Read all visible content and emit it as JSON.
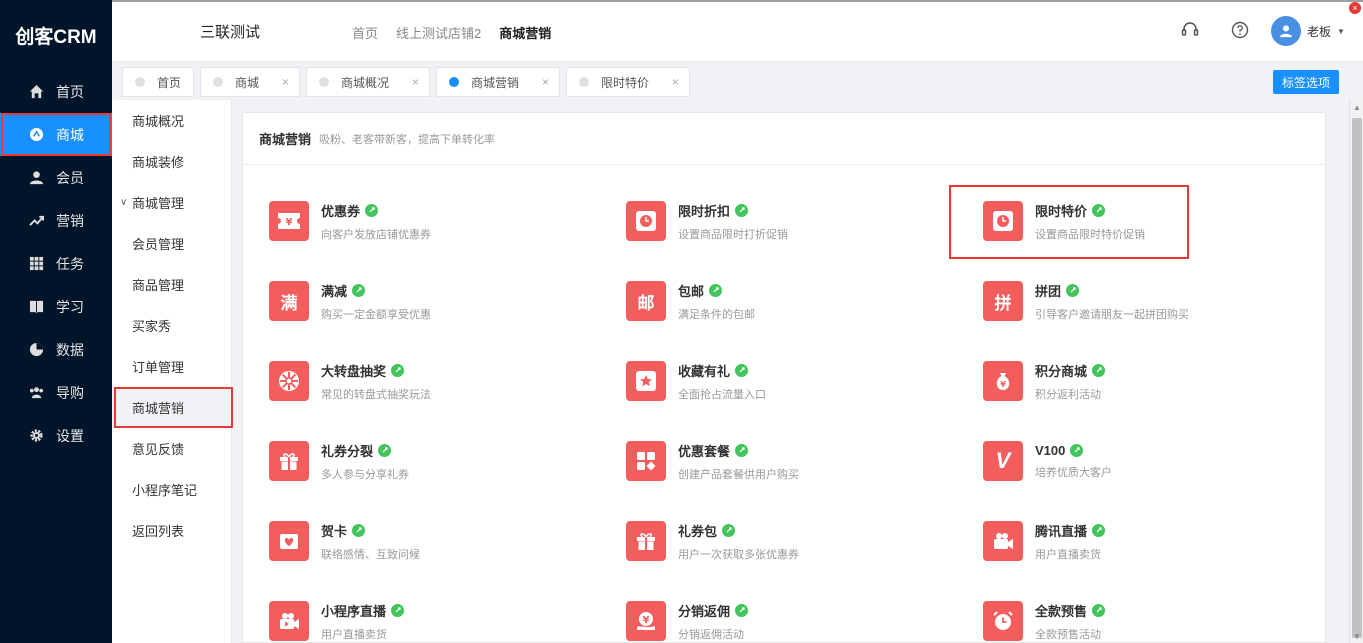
{
  "brand": "创客CRM",
  "nav": [
    {
      "label": "首页",
      "icon": "home-icon"
    },
    {
      "label": "商城",
      "icon": "shop-icon"
    },
    {
      "label": "会员",
      "icon": "member-icon"
    },
    {
      "label": "营销",
      "icon": "trend-icon"
    },
    {
      "label": "任务",
      "icon": "grid-icon"
    },
    {
      "label": "学习",
      "icon": "book-icon"
    },
    {
      "label": "数据",
      "icon": "pie-icon"
    },
    {
      "label": "导购",
      "icon": "group-icon"
    },
    {
      "label": "设置",
      "icon": "gear-icon"
    }
  ],
  "header": {
    "store": "三联测试",
    "crumbs": [
      "首页",
      "线上测试店铺2",
      "商城营销"
    ],
    "user": "老板"
  },
  "tabs": [
    {
      "label": "首页"
    },
    {
      "label": "商城"
    },
    {
      "label": "商城概况"
    },
    {
      "label": "商城营销"
    },
    {
      "label": "限时特价"
    }
  ],
  "tab_options": "标签选项",
  "submenu": [
    "商城概况",
    "商城装修",
    "商城管理",
    "会员管理",
    "商品管理",
    "买家秀",
    "订单管理",
    "商城营销",
    "意见反馈",
    "小程序笔记",
    "返回列表"
  ],
  "card": {
    "title": "商城营销",
    "subtitle": "吸粉、老客带新客，提高下单转化率"
  },
  "features": [
    {
      "name": "优惠券",
      "desc": "向客户发放店铺优惠券",
      "glyph": "¥"
    },
    {
      "name": "限时折扣",
      "desc": "设置商品限时打折促销",
      "glyph": ""
    },
    {
      "name": "限时特价",
      "desc": "设置商品限时特价促销",
      "glyph": ""
    },
    {
      "name": "满减",
      "desc": "购买一定金额享受优惠",
      "glyph": "满"
    },
    {
      "name": "包邮",
      "desc": "满足条件的包邮",
      "glyph": "邮"
    },
    {
      "name": "拼团",
      "desc": "引导客户邀请朋友一起拼团购买",
      "glyph": "拼"
    },
    {
      "name": "大转盘抽奖",
      "desc": "常见的转盘式抽奖玩法",
      "glyph": ""
    },
    {
      "name": "收藏有礼",
      "desc": "全面抢占流量入口",
      "glyph": "★"
    },
    {
      "name": "积分商城",
      "desc": "积分返利活动",
      "glyph": ""
    },
    {
      "name": "礼券分裂",
      "desc": "多人参与分享礼券",
      "glyph": ""
    },
    {
      "name": "优惠套餐",
      "desc": "创建产品套餐供用户购买",
      "glyph": ""
    },
    {
      "name": "V100",
      "desc": "培养优质大客户",
      "glyph": "V"
    },
    {
      "name": "贺卡",
      "desc": "联络感情、互致问候",
      "glyph": "♥"
    },
    {
      "name": "礼券包",
      "desc": "用户一次获取多张优惠券",
      "glyph": ""
    },
    {
      "name": "腾讯直播",
      "desc": "用户直播卖货",
      "glyph": ""
    },
    {
      "name": "小程序直播",
      "desc": "用户直播卖货",
      "glyph": ""
    },
    {
      "name": "分销返佣",
      "desc": "分销返佣活动",
      "glyph": "¥"
    },
    {
      "name": "全款预售",
      "desc": "全款预售活动",
      "glyph": ""
    }
  ]
}
